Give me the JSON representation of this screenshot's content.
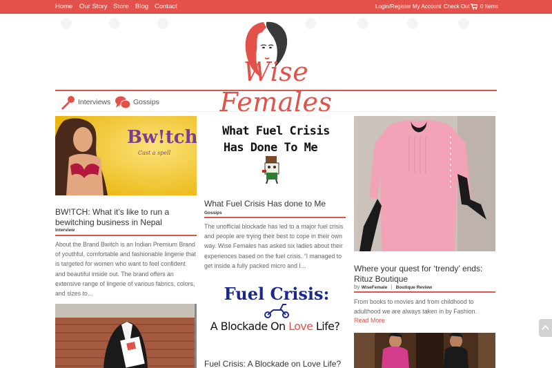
{
  "topnav": {
    "left": [
      "Home",
      "Our Story",
      "Store",
      "Blog",
      "Contact"
    ],
    "right": [
      "Login/Register",
      "My Account",
      "Check Out"
    ],
    "cart": "0 Items"
  },
  "logo": {
    "text": "Wise Females"
  },
  "categories": [
    "Interviews",
    "Gossips"
  ],
  "posts": {
    "bwitch": {
      "image_text": "Bw!tch",
      "image_tagline": "Cast a spell",
      "title": "BW!TCH: What it’s like to run a bewitching business in Nepal",
      "meta": "Interview",
      "excerpt": "About the Brand Bwitch is an Indian Premium Brand of youthful, comfortable and fashionable lingerie that is targeted for women who want to feel confident and beautiful inside out. The brand offers an extensive range of lingerie of various fabrics, colors, and sizes to..."
    },
    "fuel": {
      "image_text_1": "What Fuel Crisis",
      "image_text_2": "Has Done To Me",
      "title": "What Fuel Crisis Has done to Me",
      "meta": "Gossips",
      "excerpt": "The unofficial blockade has led to a major fuel crisis and people are trying their best to cope in their own way. Wise Females has asked six ladies about their experiences based on the fuel crisis.   “I managed to get inside a fully packed micro and I..."
    },
    "blockade": {
      "image_text_1": "Fuel Crisis:",
      "image_text_2a": "A Blockade On ",
      "image_text_2b": "Love",
      "image_text_2c": " Life?",
      "title": "Fuel Crisis: A Blockade on Love Life?"
    },
    "rituz": {
      "title": "Where your quest for ‘trendy’ ends: Rituz Boutique",
      "meta_by": "by",
      "meta_author": "WiseFemale",
      "meta_sep": "|",
      "meta_cat": "Boutique Review",
      "excerpt": "From books to movies and from childhood to adulthood we are always taken in by Fashion.",
      "readmore": "Read More"
    }
  },
  "colors": {
    "accent": "#e3524a",
    "text": "#666666",
    "title": "#333333"
  }
}
